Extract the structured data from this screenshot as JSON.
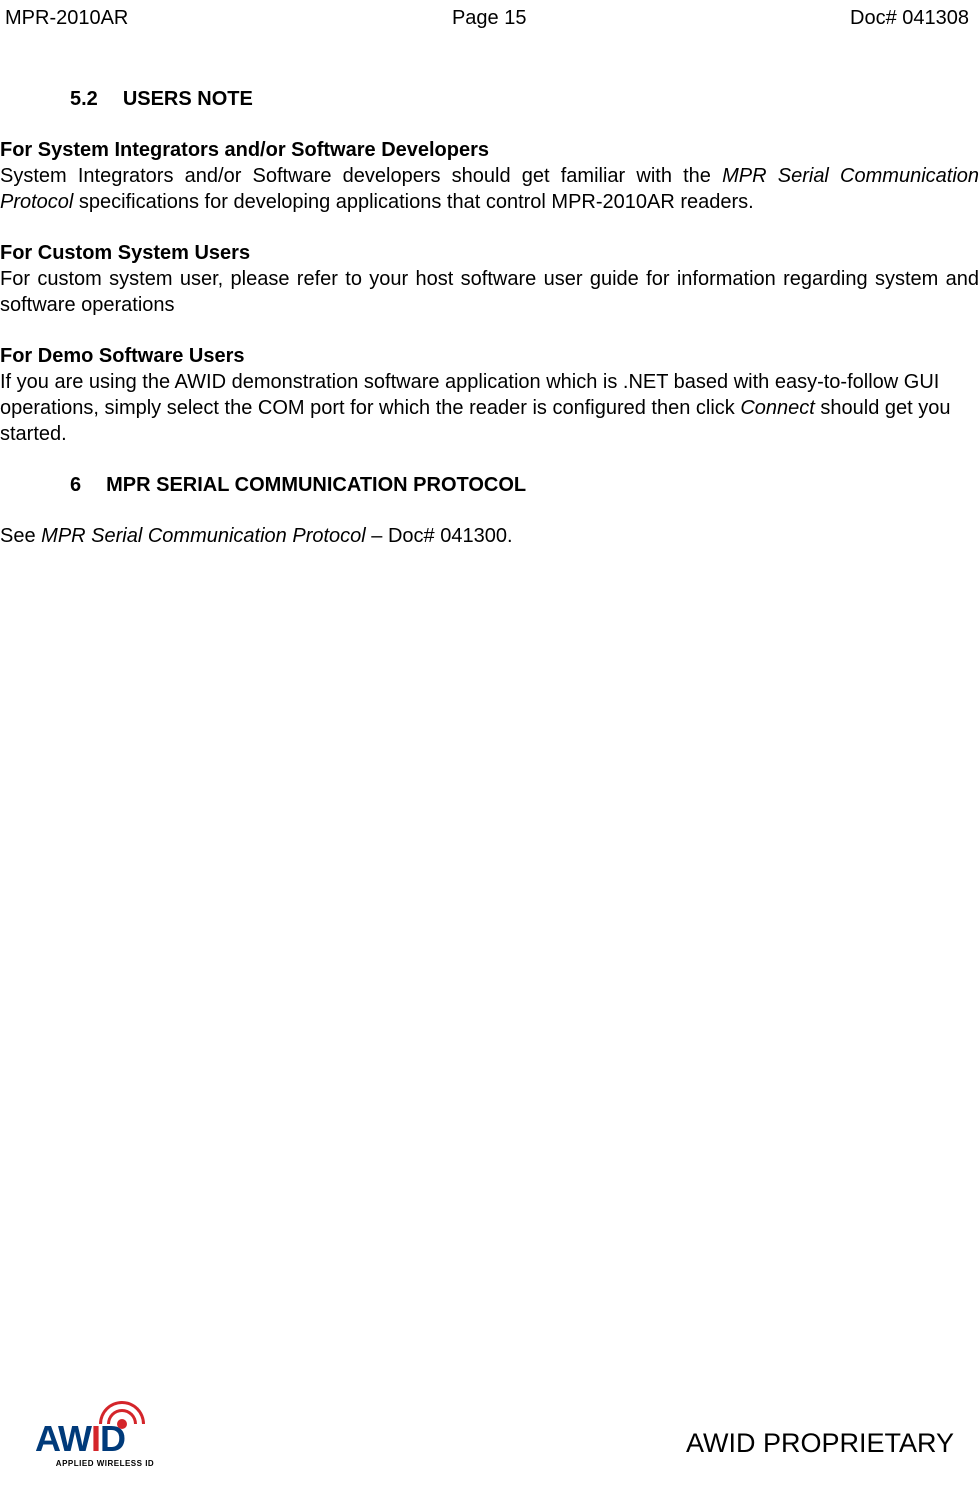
{
  "header": {
    "left": "MPR-2010AR",
    "center": "Page 15",
    "right": "Doc# 041308"
  },
  "section_5_2": {
    "number": "5.2",
    "title": "USERS NOTE"
  },
  "block1": {
    "heading": "For System Integrators and/or Software Developers",
    "text_part1": "System Integrators and/or Software developers should get familiar with the ",
    "text_italic": "MPR Serial Communication Protocol",
    "text_part2": " specifications for developing applications that control MPR-2010AR readers."
  },
  "block2": {
    "heading": "For Custom System Users",
    "text": "For custom system user, please refer to your host software user guide for information regarding system and software operations"
  },
  "block3": {
    "heading": "For Demo Software Users",
    "text_part1": "If you are using the AWID demonstration software application which is .NET based with easy-to-follow GUI operations, simply select the COM port for which the reader is configured then click ",
    "text_italic": "Connect",
    "text_part2": " should get you started."
  },
  "section_6": {
    "number": "6",
    "title": "MPR SERIAL COMMUNICATION PROTOCOL"
  },
  "section_6_text": {
    "part1": "See ",
    "italic": "MPR Serial Communication Protocol",
    "part2": " – Doc# 041300."
  },
  "footer": {
    "logo_main": "AWID",
    "logo_sub": "APPLIED WIRELESS ID",
    "right": "AWID PROPRIETARY"
  }
}
